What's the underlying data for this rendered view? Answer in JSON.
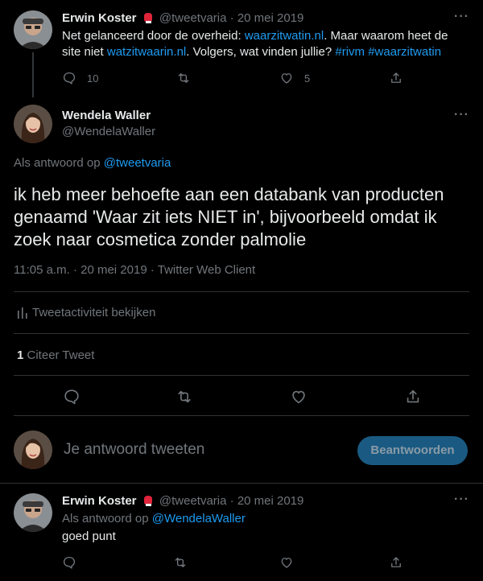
{
  "tweet1": {
    "author_name": "Erwin Koster",
    "handle": "@tweetvaria",
    "date": "20 mei 2019",
    "text_before_link1": "Net gelanceerd door de overheid: ",
    "link1": "waarzitwatin.nl",
    "text_after_link1": ". Maar waarom heet de site niet ",
    "link2": "watzitwaarin.nl",
    "text_after_link2": ". Volgers, wat vinden jullie? ",
    "hashtag1": "#rivm",
    "hashtag2": "#waarzitwatin",
    "reply_count": "10",
    "like_count": "5",
    "emoji_icon": "boxing-glove-icon"
  },
  "main_tweet": {
    "author_name": "Wendela Waller",
    "handle": "@WendelaWaller",
    "reply_to_label": "Als antwoord op",
    "reply_to_handle": "@tweetvaria",
    "text": "ik heb meer behoefte aan een databank van producten genaamd 'Waar zit iets NIET in', bijvoorbeeld omdat ik zoek naar cosmetica zonder palmolie",
    "time": "11:05 a.m.",
    "date": "20 mei 2019",
    "client": "Twitter Web Client",
    "activity_label": "Tweetactiviteit bekijken",
    "quote_count": "1",
    "quote_label": "Citeer Tweet"
  },
  "composer": {
    "placeholder": "Je antwoord tweeten",
    "reply_button": "Beantwoorden"
  },
  "reply_tweet": {
    "author_name": "Erwin Koster",
    "handle": "@tweetvaria",
    "date": "20 mei 2019",
    "reply_to_label": "Als antwoord op",
    "reply_to_handle": "@WendelaWaller",
    "text": "goed punt"
  },
  "separator": "·",
  "colors": {
    "background": "#000000",
    "text": "#e7e9ea",
    "muted": "#71767b",
    "link": "#1d9bf0",
    "divider": "#2f3336",
    "button_bg": "#1a5a82"
  }
}
